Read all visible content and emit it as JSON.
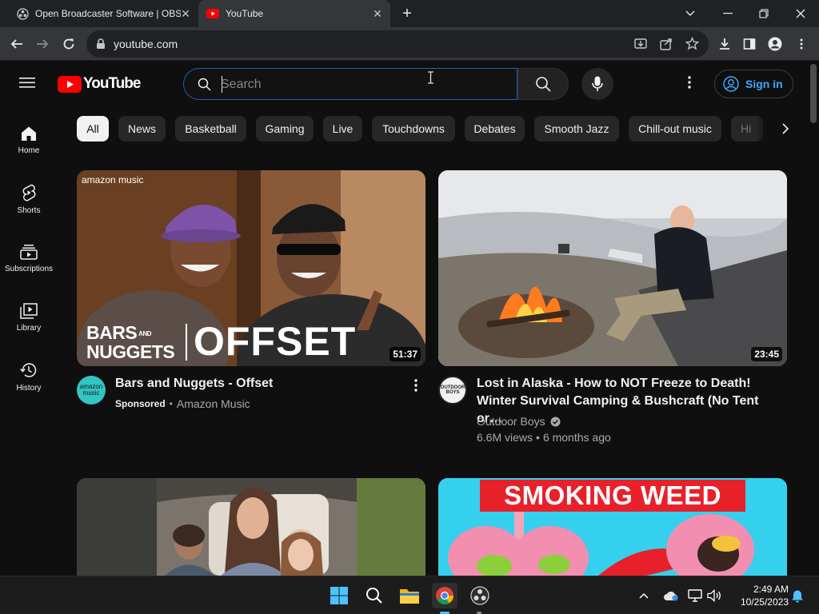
{
  "browser": {
    "tabs": [
      {
        "title": "Open Broadcaster Software | OBS",
        "active": false
      },
      {
        "title": "YouTube",
        "active": true
      }
    ],
    "address": "youtube.com"
  },
  "youtube": {
    "logo_text": "YouTube",
    "search_placeholder": "Search",
    "sign_in": "Sign in",
    "guide": [
      "Home",
      "Shorts",
      "Subscriptions",
      "Library",
      "History"
    ],
    "chips": [
      "All",
      "News",
      "Basketball",
      "Gaming",
      "Live",
      "Touchdowns",
      "Debates",
      "Smooth Jazz",
      "Chill-out music",
      "Hi"
    ],
    "videos": [
      {
        "thumb_brand": "amazon music",
        "thumb_text_left_1": "BARS",
        "thumb_text_and": "AND",
        "thumb_text_left_2": "NUGGETS",
        "thumb_text_big": "OFFSET",
        "duration": "51:37",
        "title": "Bars and Nuggets - Offset",
        "sponsored": "Sponsored",
        "channel": "Amazon Music",
        "avatar_text": "amazon music"
      },
      {
        "duration": "23:45",
        "title_line1": "Lost in Alaska - How to NOT Freeze to Death!",
        "title_line2": "Winter Survival Camping & Bushcraft (No Tent or…",
        "channel": "Outdoor Boys",
        "views": "6.6M views",
        "age": "6 months ago",
        "avatar_text": "OUTDOOR BOYS"
      },
      {
        "title": ""
      },
      {
        "thumb_text": "SMOKING WEED"
      }
    ]
  },
  "taskbar": {
    "time": "2:49 AM",
    "date": "10/25/2023"
  }
}
